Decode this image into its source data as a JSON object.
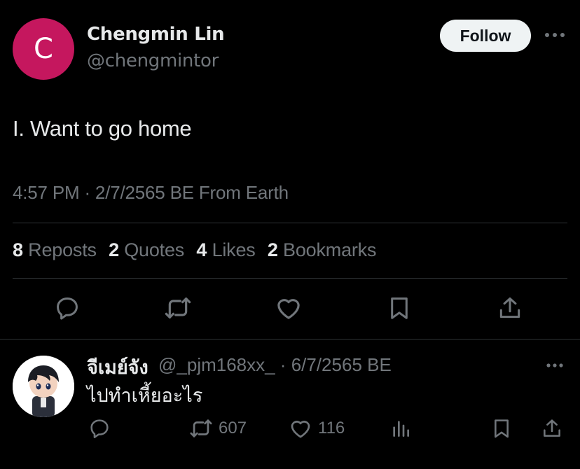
{
  "tweet": {
    "author": {
      "initial": "C",
      "name": "Chengmin Lin",
      "handle": "@chengmintor"
    },
    "follow_label": "Follow",
    "text": "I. Want to go home",
    "meta": "4:57 PM · 2/7/2565 BE From Earth",
    "stats": [
      {
        "num": "8",
        "label": "Reposts"
      },
      {
        "num": "2",
        "label": "Quotes"
      },
      {
        "num": "4",
        "label": "Likes"
      },
      {
        "num": "2",
        "label": "Bookmarks"
      }
    ]
  },
  "reply": {
    "name": "จีเมย์จัง",
    "handle_date": "@_pjm168xx_ · 6/7/2565 BE",
    "text": "ไปทำเหี้ยอะไร",
    "reposts": "607",
    "likes": "116"
  },
  "colors": {
    "accent_avatar": "#c5175e",
    "text": "#e7e9ea",
    "muted": "#71767b",
    "background": "#000000"
  }
}
